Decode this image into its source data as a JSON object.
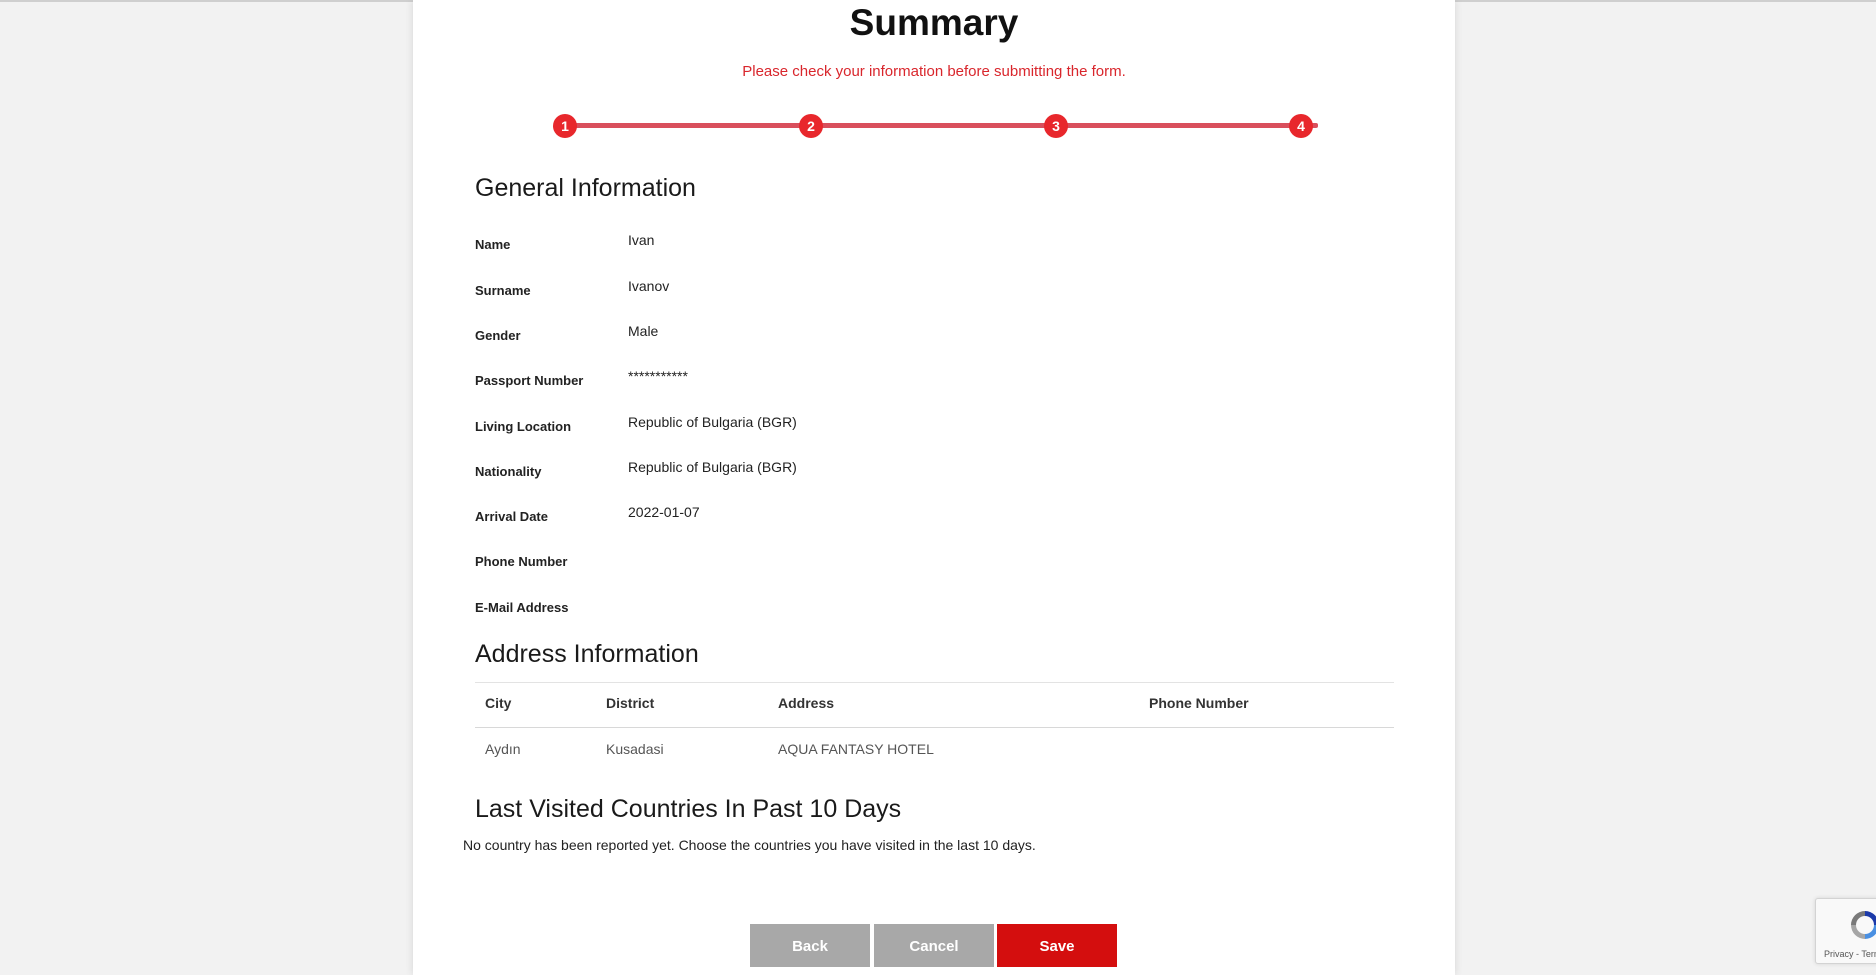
{
  "header": {
    "title": "Summary",
    "subtitle": "Please check your information before submitting the form."
  },
  "stepper": {
    "steps": [
      "1",
      "2",
      "3",
      "4"
    ],
    "accent_color": "#e8272c"
  },
  "general": {
    "title": "General Information",
    "fields": [
      {
        "label": "Name",
        "value": "Ivan"
      },
      {
        "label": "Surname",
        "value": "Ivanov"
      },
      {
        "label": "Gender",
        "value": "Male"
      },
      {
        "label": "Passport Number",
        "value": "***********"
      },
      {
        "label": "Living Location",
        "value": "Republic of Bulgaria (BGR)"
      },
      {
        "label": "Nationality",
        "value": "Republic of Bulgaria (BGR)"
      },
      {
        "label": "Arrival Date",
        "value": "2022-01-07"
      },
      {
        "label": "Phone Number",
        "value": ""
      },
      {
        "label": "E-Mail Address",
        "value": ""
      }
    ]
  },
  "address": {
    "title": "Address Information",
    "columns": [
      "City",
      "District",
      "Address",
      "Phone Number"
    ],
    "rows": [
      [
        "Aydın",
        "Kusadasi",
        "AQUA FANTASY HOTEL",
        ""
      ]
    ]
  },
  "visited": {
    "title": "Last Visited Countries In Past 10 Days",
    "note": "No country has been reported yet. Choose the countries you have visited in the last 10 days."
  },
  "actions": {
    "back_label": "Back",
    "cancel_label": "Cancel",
    "save_label": "Save"
  },
  "recaptcha": {
    "text": "Privacy - Terms"
  }
}
